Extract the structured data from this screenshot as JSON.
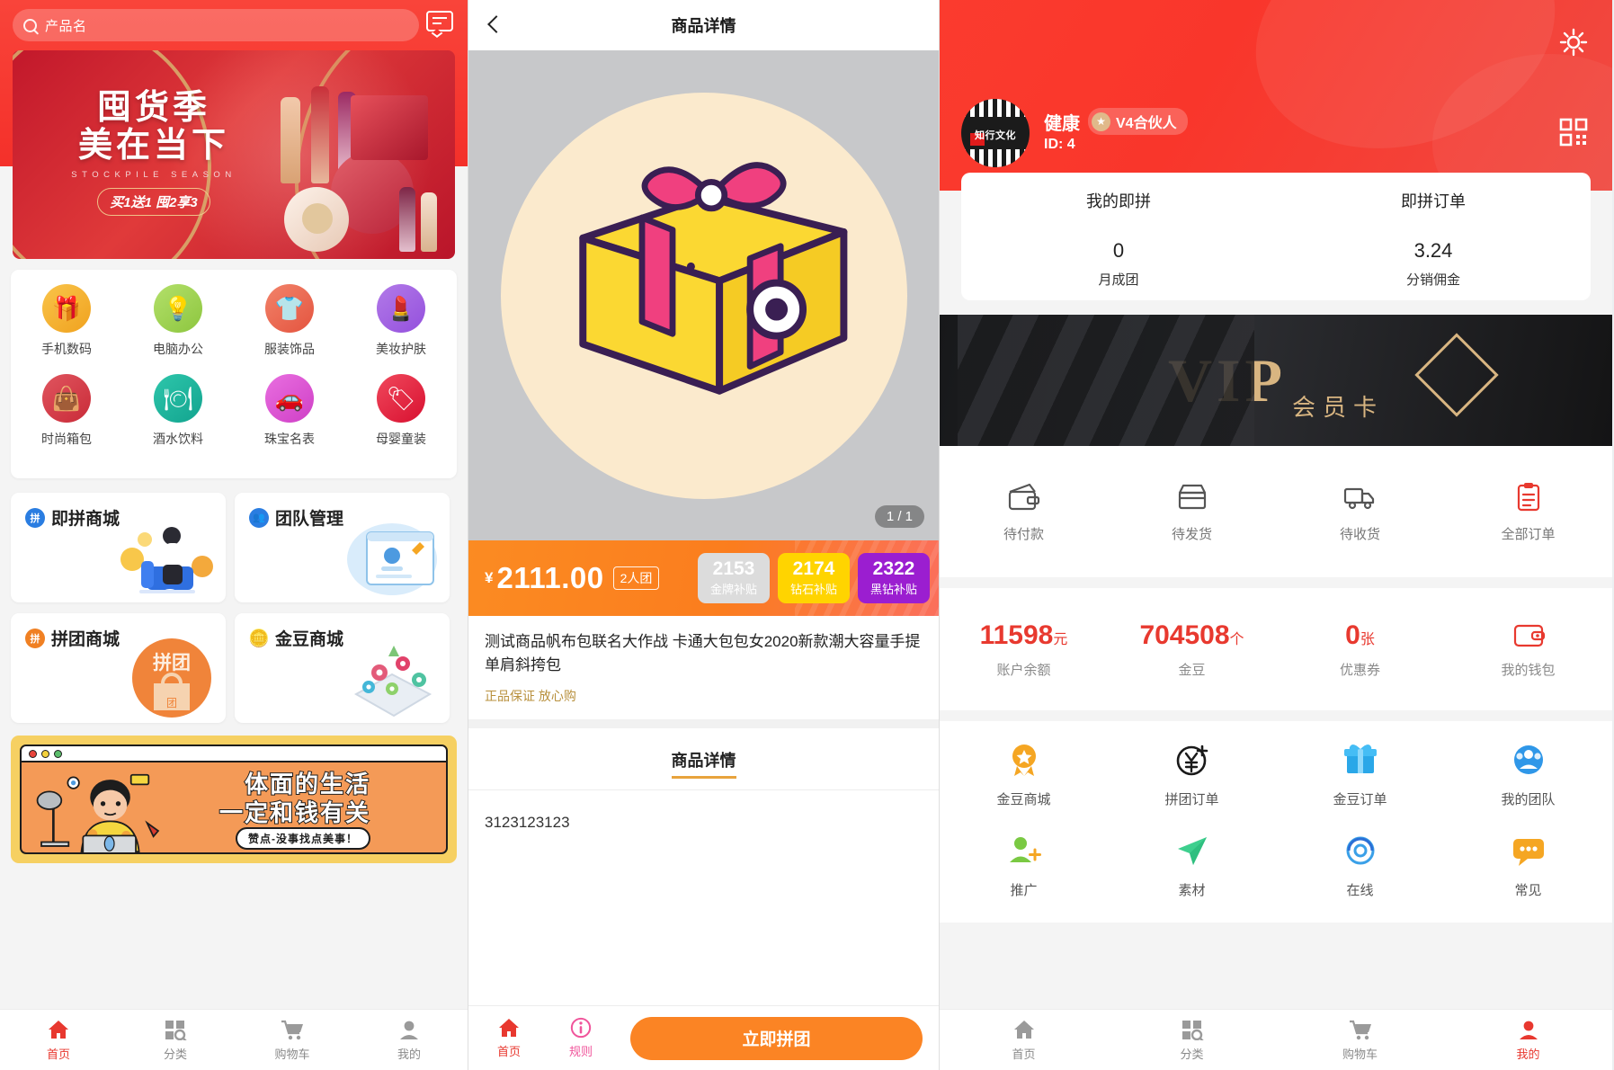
{
  "panel_home": {
    "search": {
      "placeholder": "产品名",
      "icon": "search-icon"
    },
    "message_icon": "message-icon",
    "banner": {
      "line1": "囤货季",
      "line2": "美在当下",
      "english": "STOCKPILE SEASON",
      "promo": "买1送1 囤2享3"
    },
    "categories": [
      {
        "label": "手机数码",
        "color": "#f5b battle"
      },
      {
        "label": "电脑办公"
      },
      {
        "label": "服装饰品"
      },
      {
        "label": "美妆护肤"
      },
      {
        "label": "时尚箱包"
      },
      {
        "label": "酒水饮料"
      },
      {
        "label": "珠宝名表"
      },
      {
        "label": "母婴童装"
      }
    ],
    "category_colors": [
      "#f5b52e",
      "#9ed154",
      "#ef7055",
      "#a55ce0",
      "#d9444c",
      "#19b39a",
      "#d64bd0",
      "#e5243b"
    ],
    "category_glyphs": [
      "🎁",
      "💡",
      "👕",
      "💄",
      "👜",
      "🍽",
      "🚗",
      "🏷"
    ],
    "promos": [
      {
        "title": "即拼商城",
        "badge": "拼",
        "badge_color": "#2a7de1"
      },
      {
        "title": "团队管理",
        "badge": "👥",
        "badge_color": "#2a7de1"
      },
      {
        "title": "拼团商城",
        "badge": "拼",
        "badge_color": "#f08023"
      },
      {
        "title": "金豆商城",
        "badge": "🪙",
        "badge_color": "#f0c040"
      }
    ],
    "ad": {
      "line1": "体面的生活",
      "line2": "一定和钱有关",
      "pill": "赞点-没事找点美事！"
    },
    "tabs": [
      {
        "label": "首页",
        "icon": "home-icon",
        "active": true
      },
      {
        "label": "分类",
        "icon": "category-icon",
        "active": false
      },
      {
        "label": "购物车",
        "icon": "cart-icon",
        "active": false
      },
      {
        "label": "我的",
        "icon": "user-icon",
        "active": false
      }
    ]
  },
  "panel_detail": {
    "nav": {
      "back_icon": "back-chevron-icon",
      "title": "商品详情"
    },
    "gallery": {
      "pager": "1 / 1",
      "image": "gift-box-illustration"
    },
    "price": {
      "currency": "¥",
      "amount": "2111.00",
      "group_tag": "2人团"
    },
    "subsidies": [
      {
        "value": "2153",
        "label": "金牌补贴",
        "color": "#dcdcdc"
      },
      {
        "value": "2174",
        "label": "钻石补贴",
        "color": "#ffd400"
      },
      {
        "value": "2322",
        "label": "黑钻补贴",
        "color": "#9b1ed0"
      }
    ],
    "product_title": "测试商品帆布包联名大作战 卡通大包包女2020新款潮大容量手提单肩斜挎包",
    "guarantee": "正品保证 放心购",
    "detail_tab": "商品详情",
    "detail_body": "3123123123",
    "bottom": {
      "home_label": "首页",
      "rules_label": "规则",
      "cta": "立即拼团"
    }
  },
  "panel_profile": {
    "gear_icon": "gear-icon",
    "qr_icon": "qr-code-icon",
    "user": {
      "name": "健康",
      "level": "V4合伙人",
      "id": "ID: 4",
      "avatar_text": "知行文化"
    },
    "stats": [
      {
        "header": "我的即拼",
        "value": "0",
        "sub": "月成团"
      },
      {
        "header": "即拼订单",
        "value": "3.24",
        "sub": "分销佣金"
      }
    ],
    "vip_banner": {
      "word": "VIP",
      "sub": "会员卡"
    },
    "orders": [
      {
        "label": "待付款",
        "icon": "wallet-icon"
      },
      {
        "label": "待发货",
        "icon": "store-icon"
      },
      {
        "label": "待收货",
        "icon": "truck-icon"
      },
      {
        "label": "全部订单",
        "icon": "clipboard-icon"
      }
    ],
    "balances": [
      {
        "value": "11598",
        "unit": "元",
        "caption": "账户余额"
      },
      {
        "value": "704508",
        "unit": "个",
        "caption": "金豆"
      },
      {
        "value": "0",
        "unit": "张",
        "caption": "优惠券"
      },
      {
        "value": "",
        "unit": "",
        "caption": "我的钱包",
        "icon": "wallet-outline-icon"
      }
    ],
    "grid": [
      {
        "label": "金豆商城",
        "icon": "medal-icon"
      },
      {
        "label": "拼团订单",
        "icon": "yen-plus-icon"
      },
      {
        "label": "金豆订单",
        "icon": "gift-icon"
      },
      {
        "label": "我的团队",
        "icon": "team-icon"
      },
      {
        "label": "推广",
        "icon": "person-add-icon"
      },
      {
        "label": "素材",
        "icon": "send-icon"
      },
      {
        "label": "在线",
        "icon": "headset-icon"
      },
      {
        "label": "常见",
        "icon": "chat-icon"
      }
    ],
    "tabs": [
      {
        "label": "首页",
        "icon": "home-icon",
        "active": false
      },
      {
        "label": "分类",
        "icon": "category-icon",
        "active": false
      },
      {
        "label": "购物车",
        "icon": "cart-icon",
        "active": false
      },
      {
        "label": "我的",
        "icon": "user-icon",
        "active": true
      }
    ]
  }
}
